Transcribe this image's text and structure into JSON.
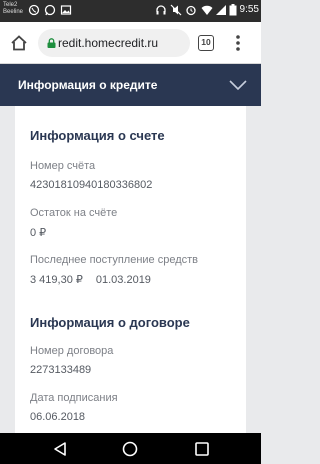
{
  "status_bar": {
    "carrier_1": "Tele2",
    "carrier_2": "Beeline",
    "time": "9:55",
    "icons": [
      "viber-icon",
      "whatsapp-icon",
      "image-icon",
      "headset-icon",
      "mute-icon",
      "alarm-icon",
      "wifi-icon",
      "signal-icon",
      "battery-icon"
    ]
  },
  "browser": {
    "url": "redit.homecredit.ru",
    "tab_count": "10",
    "icons": [
      "home-icon",
      "lock-icon",
      "more-vert-icon"
    ]
  },
  "banner": {
    "title": "Информация о кредите",
    "icon": "chevron-down-icon"
  },
  "account_info": {
    "heading": "Информация о счете",
    "account_number_label": "Номер счёта",
    "account_number": "42301810940180336802",
    "balance_label": "Остаток на счёте",
    "balance": "0 ₽",
    "last_deposit_label": "Последнее поступление средств",
    "last_deposit_amount": "3 419,30 ₽",
    "last_deposit_date": "01.03.2019"
  },
  "contract_info": {
    "heading": "Информация о договоре",
    "contract_number_label": "Номер договора",
    "contract_number": "2273133489",
    "signing_date_label": "Дата подписания",
    "signing_date": "06.06.2018"
  },
  "nav_bar": {
    "icons": [
      "back-icon",
      "home-circle-icon",
      "recents-icon"
    ]
  },
  "colors": {
    "banner": "#2a3752",
    "heading": "#2a3752",
    "page_bg": "#e9eaec"
  }
}
